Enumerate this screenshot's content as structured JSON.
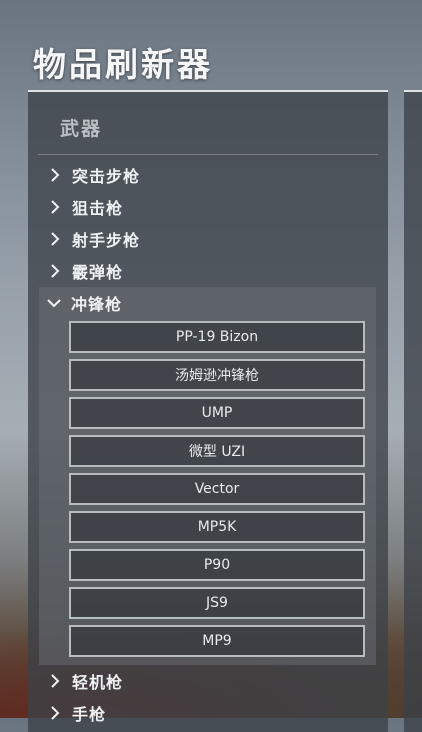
{
  "title": "物品刷新器",
  "panel": {
    "header": "武器"
  },
  "categories_before": [
    {
      "label": "突击步枪",
      "icon": "chevron-right-icon"
    },
    {
      "label": "狙击枪",
      "icon": "chevron-right-icon"
    },
    {
      "label": "射手步枪",
      "icon": "chevron-right-icon"
    },
    {
      "label": "霰弹枪",
      "icon": "chevron-right-icon"
    }
  ],
  "open_category": {
    "label": "冲锋枪",
    "icon": "chevron-down-icon",
    "items": [
      "PP-19 Bizon",
      "汤姆逊冲锋枪",
      "UMP",
      "微型 UZI",
      "Vector",
      "MP5K",
      "P90",
      "JS9",
      "MP9"
    ]
  },
  "categories_after": [
    {
      "label": "轻机枪",
      "icon": "chevron-right-icon"
    },
    {
      "label": "手枪",
      "icon": "chevron-right-icon"
    }
  ]
}
